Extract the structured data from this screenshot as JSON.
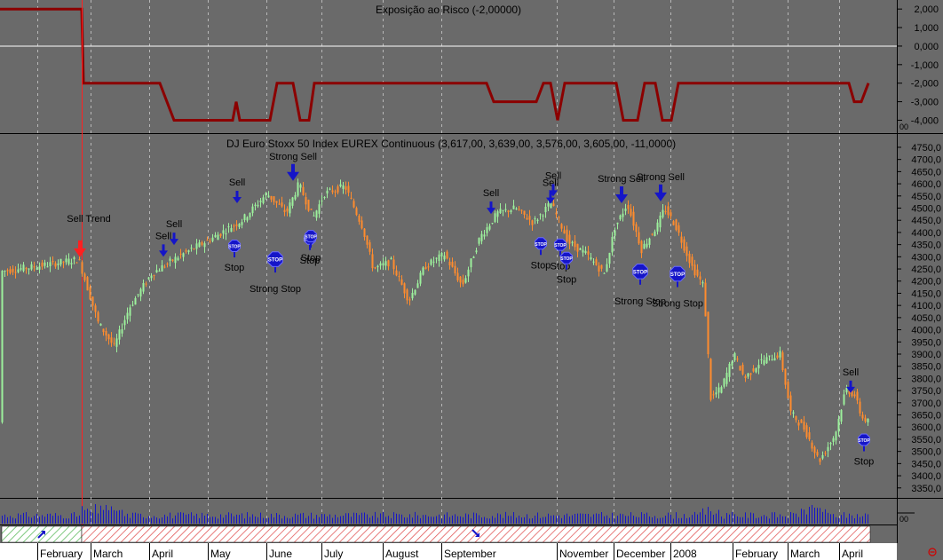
{
  "chart_data": [
    {
      "type": "line",
      "title": "Exposição ao Risco (-2,00000)",
      "ylim": [
        -4.6,
        2.2
      ],
      "y_ticks": [
        "2,000",
        "1,000",
        "0,000",
        "-1,000",
        "-2,000",
        "-3,000",
        "-4,000"
      ],
      "y_tick_values": [
        2,
        1,
        0,
        -1,
        -2,
        -3,
        -4
      ],
      "scale_label": "00",
      "color": "#8b0000",
      "series": [
        {
          "x": [
            0,
            92,
            93,
            94,
            180,
            196,
            262,
            266,
            270,
            304,
            312,
            330,
            338,
            348,
            354,
            548,
            556,
            604,
            612,
            620,
            628,
            636,
            694,
            702,
            718,
            726,
            738,
            746,
            756,
            764,
            956,
            962,
            970,
            978
          ],
          "values": [
            2,
            2,
            0,
            -2,
            -2,
            -4,
            -4,
            -3,
            -4,
            -4,
            -2,
            -2,
            -4,
            -4,
            -2,
            -2,
            -3,
            -3,
            -2,
            -2,
            -4,
            -2,
            -2,
            -4,
            -4,
            -2,
            -2,
            -4,
            -4,
            -2,
            -2,
            -3,
            -3,
            -2
          ]
        }
      ]
    },
    {
      "type": "candlestick",
      "title": "DJ Euro Stoxx 50 Index EUREX Continuous (3,617,00, 3,639,00, 3,576,00, 3,605,00, -11,0000)",
      "ylim": [
        3320,
        4790
      ],
      "y_ticks": [
        "4750,0",
        "4700,0",
        "4650,0",
        "4600,0",
        "4550,0",
        "4500,0",
        "4450,0",
        "4400,0",
        "4350,0",
        "4300,0",
        "4250,0",
        "4200,0",
        "4150,0",
        "4100,0",
        "4050,0",
        "4000,0",
        "3950,0",
        "3900,0",
        "3850,0",
        "3800,0",
        "3750,0",
        "3700,0",
        "3650,0",
        "3600,0",
        "3550,0",
        "3500,0",
        "3450,0",
        "3400,0",
        "3350,0"
      ],
      "y_tick_values": [
        4750,
        4700,
        4650,
        4600,
        4550,
        4500,
        4450,
        4400,
        4350,
        4300,
        4250,
        4200,
        4150,
        4100,
        4050,
        4000,
        3950,
        3900,
        3850,
        3800,
        3750,
        3700,
        3650,
        3600,
        3550,
        3500,
        3450,
        3400,
        3350
      ],
      "up_color": "#9cf09c",
      "down_color": "#ff8c2e",
      "price_path": [
        [
          0,
          4240
        ],
        [
          40,
          4260
        ],
        [
          88,
          4290
        ],
        [
          94,
          4220
        ],
        [
          110,
          4030
        ],
        [
          128,
          3930
        ],
        [
          145,
          4090
        ],
        [
          170,
          4230
        ],
        [
          200,
          4300
        ],
        [
          240,
          4380
        ],
        [
          272,
          4450
        ],
        [
          300,
          4560
        ],
        [
          322,
          4480
        ],
        [
          336,
          4600
        ],
        [
          352,
          4460
        ],
        [
          365,
          4560
        ],
        [
          388,
          4590
        ],
        [
          408,
          4420
        ],
        [
          420,
          4250
        ],
        [
          440,
          4280
        ],
        [
          460,
          4120
        ],
        [
          478,
          4260
        ],
        [
          500,
          4310
        ],
        [
          520,
          4180
        ],
        [
          540,
          4380
        ],
        [
          560,
          4480
        ],
        [
          580,
          4500
        ],
        [
          600,
          4440
        ],
        [
          620,
          4520
        ],
        [
          640,
          4360
        ],
        [
          660,
          4310
        ],
        [
          680,
          4230
        ],
        [
          692,
          4420
        ],
        [
          706,
          4520
        ],
        [
          722,
          4330
        ],
        [
          740,
          4430
        ],
        [
          748,
          4500
        ],
        [
          760,
          4430
        ],
        [
          780,
          4250
        ],
        [
          792,
          4180
        ],
        [
          800,
          3720
        ],
        [
          812,
          3760
        ],
        [
          826,
          3900
        ],
        [
          838,
          3800
        ],
        [
          856,
          3870
        ],
        [
          878,
          3900
        ],
        [
          890,
          3660
        ],
        [
          906,
          3590
        ],
        [
          922,
          3460
        ],
        [
          940,
          3570
        ],
        [
          952,
          3760
        ],
        [
          962,
          3730
        ],
        [
          970,
          3640
        ],
        [
          978,
          3620
        ]
      ],
      "scale_label": "00",
      "signals": [
        {
          "type": "sell_trend",
          "label": "Sell Trend",
          "value": 4298,
          "x_label": "February"
        },
        {
          "type": "sell",
          "label": "Sell",
          "value": 4300
        },
        {
          "type": "sell",
          "label": "Sell",
          "value": 4348
        },
        {
          "type": "sell",
          "label": "Sell",
          "value": 4520
        },
        {
          "type": "strong_sell",
          "label": "Strong Sell",
          "value": 4612
        },
        {
          "type": "sell",
          "label": "Sell",
          "value": 4476
        },
        {
          "type": "sell",
          "label": "Sell",
          "value": 4518
        },
        {
          "type": "sell",
          "label": "Sell",
          "value": 4548
        },
        {
          "type": "strong_sell",
          "label": "Strong Sell",
          "value": 4520
        },
        {
          "type": "strong_sell",
          "label": "Strong Sell",
          "value": 4528
        },
        {
          "type": "sell",
          "label": "Sell",
          "value": 3740
        },
        {
          "type": "stop",
          "label": "Stop",
          "value": 4345
        },
        {
          "type": "strong_stop",
          "label": "Strong Stop",
          "value": 4290
        },
        {
          "type": "stop",
          "label": "Stop",
          "value": 4375
        },
        {
          "type": "stop",
          "label": "Stop",
          "value": 4385
        },
        {
          "type": "stop",
          "label": "Stop",
          "value": 4355
        },
        {
          "type": "stop",
          "label": "Stop",
          "value": 4350
        },
        {
          "type": "stop",
          "label": "Stop",
          "value": 4295
        },
        {
          "type": "strong_stop",
          "label": "Strong Stop",
          "value": 4240
        },
        {
          "type": "strong_stop",
          "label": "Strong Stop",
          "value": 4230
        },
        {
          "type": "stop",
          "label": "Stop",
          "value": 3548
        }
      ],
      "stop_icon_text": "STOP"
    },
    {
      "type": "bar",
      "title": "",
      "series_name": "",
      "scale_label": "00",
      "color": "#1515c8",
      "description_volume_max": 1
    }
  ],
  "trend_strip": {
    "up_color": "#7ec87e",
    "down_color": "#e05050"
  },
  "x_axis": {
    "labels": [
      "February",
      "March",
      "April",
      "May",
      "June",
      "July",
      "August",
      "September",
      "November",
      "December",
      "2008",
      "February",
      "March",
      "April"
    ]
  },
  "corner_icon": "close-circle-icon"
}
